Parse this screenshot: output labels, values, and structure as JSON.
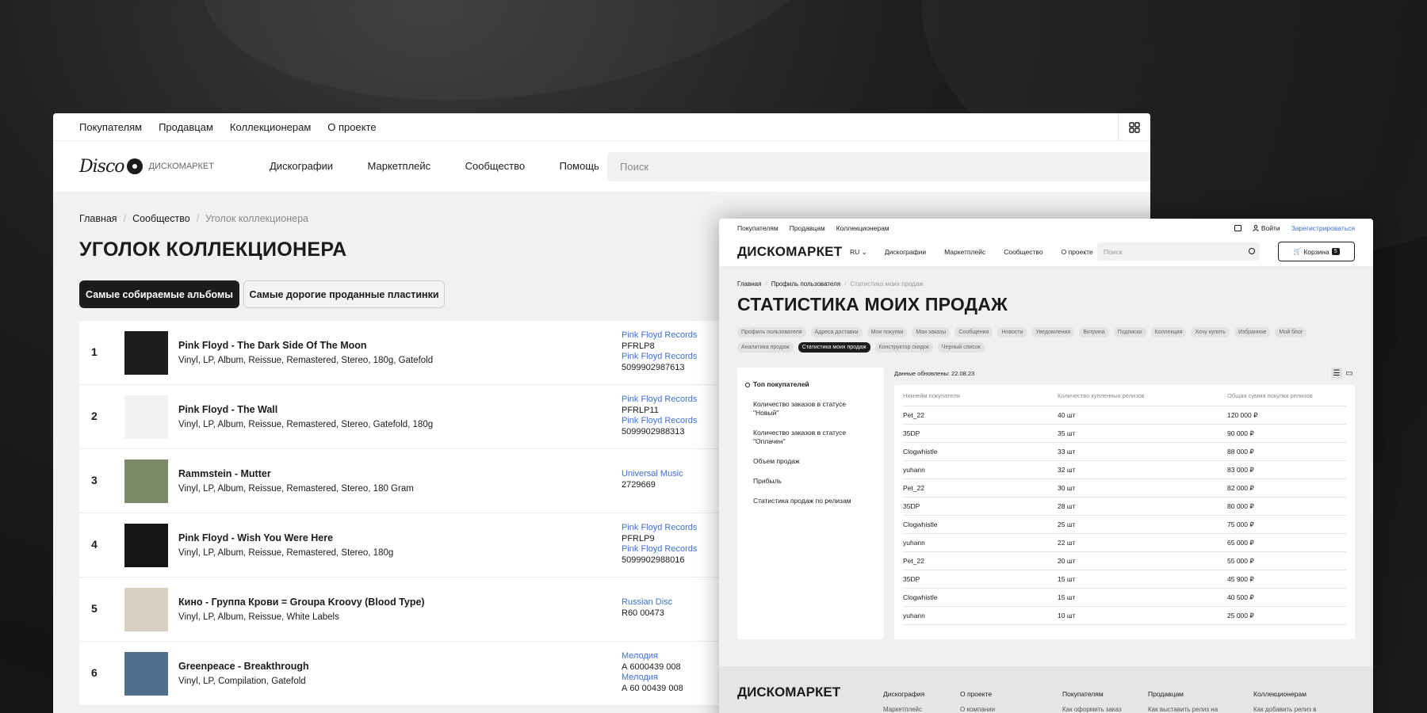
{
  "left": {
    "topbar": [
      "Покупателям",
      "Продавцам",
      "Коллекционерам",
      "О проекте"
    ],
    "logo_text": "ДИСКОМАРКЕТ",
    "logo_script": "Disco",
    "nav": [
      "Дискографии",
      "Маркетплейс",
      "Сообщество",
      "Помощь"
    ],
    "search_placeholder": "Поиск",
    "breadcrumbs": [
      "Главная",
      "Сообщество",
      "Уголок коллекционера"
    ],
    "title": "УГОЛОК КОЛЛЕКЦИОНЕРА",
    "tabs": [
      "Самые собираемые альбомы",
      "Самые дорогие проданные пластинки"
    ],
    "rows": [
      {
        "rank": "1",
        "title": "Pink Floyd - The Dark Side Of The Moon",
        "format": "Vinyl, LP, Album, Reissue, Remastered, Stereo, 180g, Gatefold",
        "label1": "Pink Floyd Records",
        "cat1": "PFRLP8",
        "label2": "Pink Floyd Records",
        "cat2": "5099902987613",
        "cover": "#1c1c1c"
      },
      {
        "rank": "2",
        "title": "Pink Floyd - The Wall",
        "format": "Vinyl, LP, Album, Reissue, Remastered, Stereo, Gatefold, 180g",
        "label1": "Pink Floyd Records",
        "cat1": "PFRLP11",
        "label2": "Pink Floyd Records",
        "cat2": "5099902988313",
        "cover": "#f2f2f2"
      },
      {
        "rank": "3",
        "title": "Rammstein - Mutter",
        "format": "Vinyl, LP, Album, Reissue, Remastered, Stereo, 180 Gram",
        "label1": "Universal Music",
        "cat1": "2729669",
        "label2": "",
        "cat2": "",
        "cover": "#7c8a68"
      },
      {
        "rank": "4",
        "title": "Pink Floyd - Wish You Were Here",
        "format": "Vinyl, LP, Album, Reissue, Remastered, Stereo, 180g",
        "label1": "Pink Floyd Records",
        "cat1": "PFRLP9",
        "label2": "Pink Floyd Records",
        "cat2": "5099902988016",
        "cover": "#151515"
      },
      {
        "rank": "5",
        "title": "Кино - Группа Крови = Groupa Kroovy (Blood Type)",
        "format": "Vinyl, LP, Album, Reissue, White Labels",
        "label1": "Russian Disc",
        "cat1": "R60 00473",
        "label2": "",
        "cat2": "",
        "cover": "#d8cfc1"
      },
      {
        "rank": "6",
        "title": "Greenpeace - Breakthrough",
        "format": "Vinyl, LP, Compilation, Gatefold",
        "label1": "Мелодия",
        "cat1": "А 6000439 008",
        "label2": "Мелодия",
        "cat2": "А 60 00439 008",
        "cover": "#4f6f8c"
      }
    ]
  },
  "right": {
    "topbar": [
      "Покупателям",
      "Продавцам",
      "Коллекционерам"
    ],
    "login": "Войти",
    "register": "Зарегистрироваться",
    "logo": "ДИСКОМАРКЕТ",
    "lang": "RU",
    "nav": [
      "Дискографии",
      "Маркетплейс",
      "Сообщество",
      "О проекте"
    ],
    "search_placeholder": "Поиск",
    "cart": "Корзина",
    "cart_count": "5",
    "breadcrumbs": [
      "Главная",
      "Профиль пользователя",
      "Статистика моих продаж"
    ],
    "title": "СТАТИСТИКА МОИХ ПРОДАЖ",
    "chips": [
      "Профиль пользователя",
      "Адреса доставки",
      "Мои покупки",
      "Мои заказы",
      "Сообщения",
      "Новости",
      "Уведомления",
      "Витрина",
      "Подписки",
      "Коллекция",
      "Хочу купить",
      "Избранное",
      "Мой блог",
      "Аналитика продаж",
      "Статистика моих продаж",
      "Конструктор скидок",
      "Черный список"
    ],
    "active_chip": 14,
    "side": [
      "Топ покупателей",
      "Количество заказов в статусе \"Новый\"",
      "Количество заказов в статусе \"Оплачен\"",
      "Объем продаж",
      "Прибыль",
      "Статистика продаж по релизам"
    ],
    "updated": "Данные обновлены: 22.08.23",
    "table_head": [
      "Никнейм покупателя",
      "Количество купленных релизов",
      "Общая сумма покупки релизов"
    ],
    "table_rows": [
      [
        "Pet_22",
        "40 шт",
        "120 000 ₽"
      ],
      [
        "35DP",
        "35 шт",
        "90 000 ₽"
      ],
      [
        "Clogwhistle",
        "33 шт",
        "88 000 ₽"
      ],
      [
        "yuhann",
        "32 шт",
        "83 000 ₽"
      ],
      [
        "Pet_22",
        "30 шт",
        "82 000 ₽"
      ],
      [
        "35DP",
        "28 шт",
        "80 000 ₽"
      ],
      [
        "Clogwhistle",
        "25 шт",
        "75 000 ₽"
      ],
      [
        "yuhann",
        "22 шт",
        "65 000 ₽"
      ],
      [
        "Pet_22",
        "20 шт",
        "55 000 ₽"
      ],
      [
        "35DP",
        "15 шт",
        "45 900 ₽"
      ],
      [
        "Clogwhistle",
        "15 шт",
        "40 500 ₽"
      ],
      [
        "yuhann",
        "10 шт",
        "25 000 ₽"
      ]
    ],
    "footer": {
      "logo": "ДИСКОМАРКЕТ",
      "cols": [
        {
          "title": "Дискография",
          "sub": "Маркетплейс"
        },
        {
          "title": "О проекте",
          "sub": "О компании"
        },
        {
          "title": "Покупателям",
          "sub": "Как оформить заказ"
        },
        {
          "title": "Продавцам",
          "sub": "Как выставить релиз на"
        },
        {
          "title": "Коллекционерам",
          "sub": "Как добавить релиз в"
        }
      ]
    }
  }
}
